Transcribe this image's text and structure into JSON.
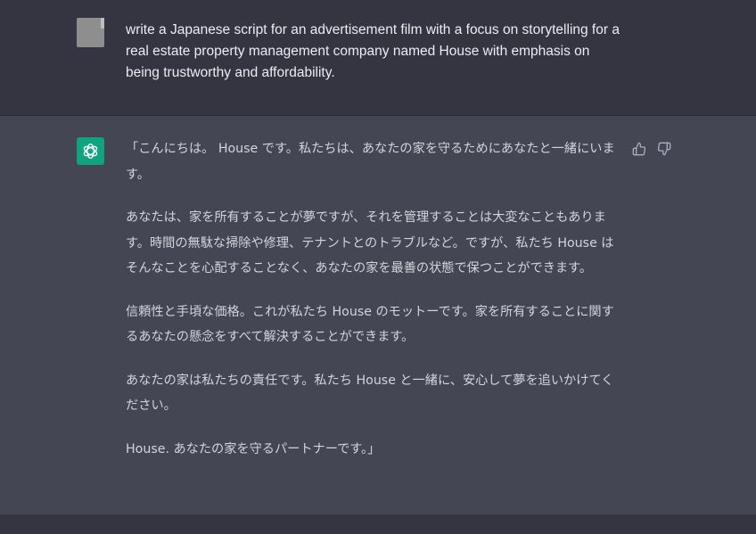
{
  "user_message": {
    "text": "write a Japanese script for an advertisement film with a focus on storytelling for a real estate property management company named House with emphasis on being trustworthy and affordability."
  },
  "assistant_message": {
    "paragraphs": [
      "「こんにちは。 House です。私たちは、あなたの家を守るためにあなたと一緒にいます。",
      "あなたは、家を所有することが夢ですが、それを管理することは大変なこともあります。時間の無駄な掃除や修理、テナントとのトラブルなど。ですが、私たち House はそんなことを心配することなく、あなたの家を最善の状態で保つことができます。",
      "信頼性と手頃な価格。これが私たち House のモットーです。家を所有することに関するあなたの懸念をすべて解決することができます。",
      "あなたの家は私たちの責任です。私たち House と一緒に、安心して夢を追いかけてください。",
      "House. あなたの家を守るパートナーです。」"
    ]
  },
  "icons": {
    "user_avatar": "user-avatar",
    "assistant_avatar": "openai-logo-icon",
    "thumbs_up": "thumbs-up-icon",
    "thumbs_down": "thumbs-down-icon"
  },
  "colors": {
    "user_bg": "#343541",
    "assistant_bg": "#444654",
    "accent": "#10a37f"
  }
}
